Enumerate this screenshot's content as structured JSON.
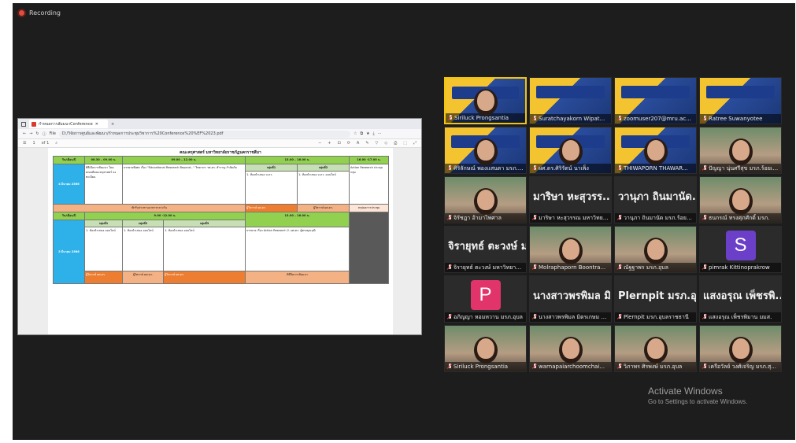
{
  "recording": {
    "label": "Recording"
  },
  "browser": {
    "tab_title": "กำหนดการสัมมนาConference",
    "file_label": "File",
    "url": "D:/วิจัยการศูนย์และพัฒนา/กำหนดการประชุมวิชาการ%20Conference%20%EF%2023.pdf",
    "page_label": "1",
    "page_total": "of 1"
  },
  "document": {
    "title": "คณะครุศาสตร์ มหาวิทยาลัยราชภัฏนครราชสีมา",
    "day1": {
      "date_header": "วัน/เดือน/ปี",
      "slot1": "08.30 – 09.00 น.",
      "slot2": "09.00 – 12.00 น.",
      "slot3": "13.00 – 16.00 น.",
      "slot4": "16.00 -17.00 น.",
      "date_cell": "4 มีนาคม 2566",
      "registration": "พิธีเปิดการสัมมนา โดย คณบดีคณะครุศาสตร์ ลงทะเบียน",
      "keynote": "บรรยายพิเศษ เรื่อง \"Educational Research Beyond...\" วิทยากร: รศ.ดร. สำราญ กำจัดภัย",
      "group1": "กลุ่มที่1",
      "group2": "กลุ่มที่2",
      "group3": "กลุ่มที่3",
      "g1_text": "1. ห้องนำเสนอ บ.ลว.",
      "g2_text": "1. ห้องนำเสนอ บ.ลว. ออนไลน์",
      "g3_text": "1. ห้องนำเสนอ บ.ลว. ออนไลน์",
      "closing": "Action Research ประชุมกลุ่ม",
      "lunch": "พักรับประทานอาหารกลางวัน",
      "orange1": "ผู้วิพากษ์ ผศ.ดร.",
      "orange2": "ผู้วิพากษ์ ผศ.ดร.",
      "orange3": "ผู้วิพากษ์ ผศ.ดร.",
      "orange4": "สรุปผลการประชุม"
    },
    "day2": {
      "date_header": "วัน/เดือน/ปี",
      "slot2": "9.00 -12.00 น.",
      "slot3": "13.00 – 16.00 น.",
      "date_cell": "5 มีนาคม 2566",
      "group1": "กลุ่มที่1",
      "group2": "กลุ่มที่2",
      "group3": "กลุ่มที่3",
      "g1_text": "1. ห้องนำเสนอ ออนไลน์",
      "g2_text": "1. ห้องนำเสนอ ออนไลน์",
      "g3_text": "1. ห้องนำเสนอ ออนไลน์",
      "afternoon": "บรรยาย เรื่อง Action Research 2. ผศ.ดร. ผู้ทรงคุณวุฒิ",
      "footer": "พิธีปิดการสัมมนา"
    }
  },
  "participants": [
    {
      "name": "Siriluck Prongsantia",
      "kind": "poster-face",
      "active": true
    },
    {
      "name": "Suratchayakorn Wipat...",
      "kind": "poster"
    },
    {
      "name": "zoomuser207@mru.ac...",
      "kind": "poster"
    },
    {
      "name": "Ratree Suwanyotee",
      "kind": "poster"
    },
    {
      "name": "ศิริลักษณ์ พองแสนตา มรภ.อุบล",
      "kind": "poster-face"
    },
    {
      "name": "ผศ.ดร.ศิริรัตน์ นาเพ็ง",
      "kind": "poster-face"
    },
    {
      "name": "THIWAPORN THAWAR...",
      "kind": "poster-face"
    },
    {
      "name": "ปัญญา นุ่นศรีสุข มรภ.ร้อยเอ็ด",
      "kind": "photo"
    },
    {
      "name": "จิรัชฎา อ้ามาไพศาล",
      "kind": "photo"
    },
    {
      "name": "มาริษา หะสุวรรณ มหาวิทยาลัย",
      "kind": "bigname",
      "big": "มาริษา หะสุวรร..."
    },
    {
      "name": "วานุภา ถินมานัด มรภ.ร้อยเอ็ด",
      "kind": "bigname",
      "big": "วานุภา ถินมานัด..."
    },
    {
      "name": "ธนกรณ์ ทรงศุภศักดิ์ มรภ.",
      "kind": "photo"
    },
    {
      "name": "จิรายุทธ์ ตะวงษ์ มหาวิทยาลัย...",
      "kind": "bigname",
      "big": "จิรายุทธ์ ตะวงษ์ ม..."
    },
    {
      "name": "Molraphaporn Boontra...",
      "kind": "photo"
    },
    {
      "name": "ณัฐฐาพร มรภ.อุบล",
      "kind": "photo"
    },
    {
      "name": "pimrak Kittinoprakrow",
      "kind": "avatar",
      "letter": "S",
      "color": "#6b3fc7"
    },
    {
      "name": "อภิญญา หอมหวาน มรภ.อุบล",
      "kind": "avatar",
      "letter": "P",
      "color": "#e0346a"
    },
    {
      "name": "นางสาวพรพิมล มิตรเกษม ม...",
      "kind": "bigname",
      "big": "นางสาวพรพิมล มิ..."
    },
    {
      "name": "Plernpit มรภ.อุบลราชธานี",
      "kind": "bigname",
      "big": "Plernpit มรภ.อุบ..."
    },
    {
      "name": "แสงอรุณ เพ็ชรพิมาน มมส.",
      "kind": "bigname",
      "big": "แสงอรุณ เพ็ชรพิ..."
    },
    {
      "name": "Siriluck Prongsantia",
      "kind": "photo"
    },
    {
      "name": "warnapaiarchoomchai...",
      "kind": "photo"
    },
    {
      "name": "วิภาพร ศิรพงษ์ มรภ.อุบล",
      "kind": "photo"
    },
    {
      "name": "เครือวัลย์ วงศ์เจริญ มรภ.สุ...",
      "kind": "photo"
    }
  ],
  "windows_watermark": {
    "line1": "Activate Windows",
    "line2": "Go to Settings to activate Windows."
  }
}
